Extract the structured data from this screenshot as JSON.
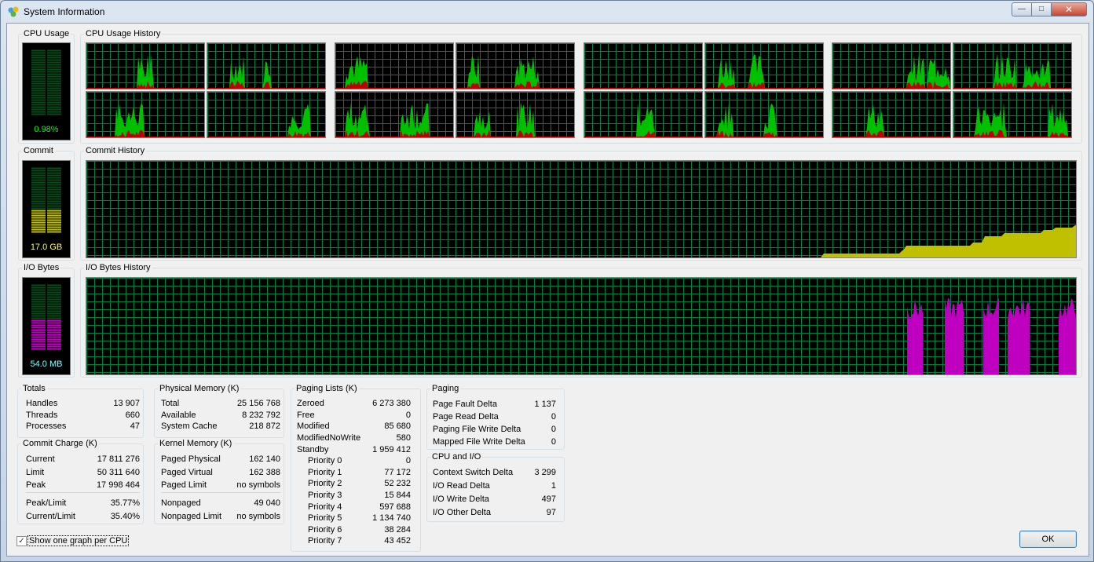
{
  "window": {
    "title": "System Information",
    "icon": "system-info-icon",
    "minimize": "—",
    "maximize": "□",
    "close": "✕"
  },
  "cpu": {
    "label": "CPU Usage",
    "value": "0.98%",
    "history_label": "CPU Usage History",
    "usage_fraction": 0.0098
  },
  "commit": {
    "label": "Commit",
    "value": "17.0 GB",
    "history_label": "Commit History",
    "fill_fraction": 0.35
  },
  "io": {
    "label": "I/O Bytes",
    "value": "54.0  MB",
    "history_label": "I/O Bytes History",
    "fill_fraction": 0.45
  },
  "colors": {
    "grid": "#008040",
    "cpu_fill": "#00c000",
    "cpu_kernel": "#c00000",
    "commit_fill": "#c0c000",
    "io_fill": "#c000c0"
  },
  "totals": {
    "title": "Totals",
    "rows": [
      {
        "label": "Handles",
        "value": "13 907"
      },
      {
        "label": "Threads",
        "value": "660"
      },
      {
        "label": "Processes",
        "value": "47"
      }
    ]
  },
  "commit_charge": {
    "title": "Commit Charge (K)",
    "rows": [
      {
        "label": "Current",
        "value": "17 811 276"
      },
      {
        "label": "Limit",
        "value": "50 311 640"
      },
      {
        "label": "Peak",
        "value": "17 998 464"
      },
      {
        "label": "Peak/Limit",
        "value": "35.77%"
      },
      {
        "label": "Current/Limit",
        "value": "35.40%"
      }
    ]
  },
  "physical_memory": {
    "title": "Physical Memory (K)",
    "rows": [
      {
        "label": "Total",
        "value": "25 156 768"
      },
      {
        "label": "Available",
        "value": "8 232 792"
      },
      {
        "label": "System Cache",
        "value": "218 872"
      }
    ]
  },
  "kernel_memory": {
    "title": "Kernel Memory (K)",
    "rows": [
      {
        "label": "Paged Physical",
        "value": "162 140"
      },
      {
        "label": "Paged Virtual",
        "value": "162 388"
      },
      {
        "label": "Paged Limit",
        "value": "no symbols"
      },
      {
        "label": "Nonpaged",
        "value": "49 040"
      },
      {
        "label": "Nonpaged Limit",
        "value": "no symbols"
      }
    ]
  },
  "paging_lists": {
    "title": "Paging Lists (K)",
    "rows": [
      {
        "label": "Zeroed",
        "value": "6 273 380"
      },
      {
        "label": "Free",
        "value": "0"
      },
      {
        "label": "Modified",
        "value": "85 680"
      },
      {
        "label": "ModifiedNoWrite",
        "value": "580"
      },
      {
        "label": "Standby",
        "value": "1 959 412"
      },
      {
        "label": "Priority 0",
        "value": "0"
      },
      {
        "label": "Priority 1",
        "value": "77 172"
      },
      {
        "label": "Priority 2",
        "value": "52 232"
      },
      {
        "label": "Priority 3",
        "value": "15 844"
      },
      {
        "label": "Priority 4",
        "value": "597 688"
      },
      {
        "label": "Priority 5",
        "value": "1 134 740"
      },
      {
        "label": "Priority 6",
        "value": "38 284"
      },
      {
        "label": "Priority 7",
        "value": "43 452"
      }
    ]
  },
  "paging": {
    "title": "Paging",
    "rows": [
      {
        "label": "Page Fault Delta",
        "value": "1 137"
      },
      {
        "label": "Page Read Delta",
        "value": "0"
      },
      {
        "label": "Paging File Write Delta",
        "value": "0"
      },
      {
        "label": "Mapped File Write Delta",
        "value": "0"
      }
    ]
  },
  "cpu_io": {
    "title": "CPU and I/O",
    "rows": [
      {
        "label": "Context Switch Delta",
        "value": "3 299"
      },
      {
        "label": "I/O Read Delta",
        "value": "1"
      },
      {
        "label": "I/O Write Delta",
        "value": "497"
      },
      {
        "label": "I/O Other Delta",
        "value": "97"
      }
    ]
  },
  "options": {
    "show_one_graph_label": "Show one graph per CPU",
    "show_one_graph_checked": true,
    "check_mark": "✓"
  },
  "buttons": {
    "ok": "OK"
  }
}
